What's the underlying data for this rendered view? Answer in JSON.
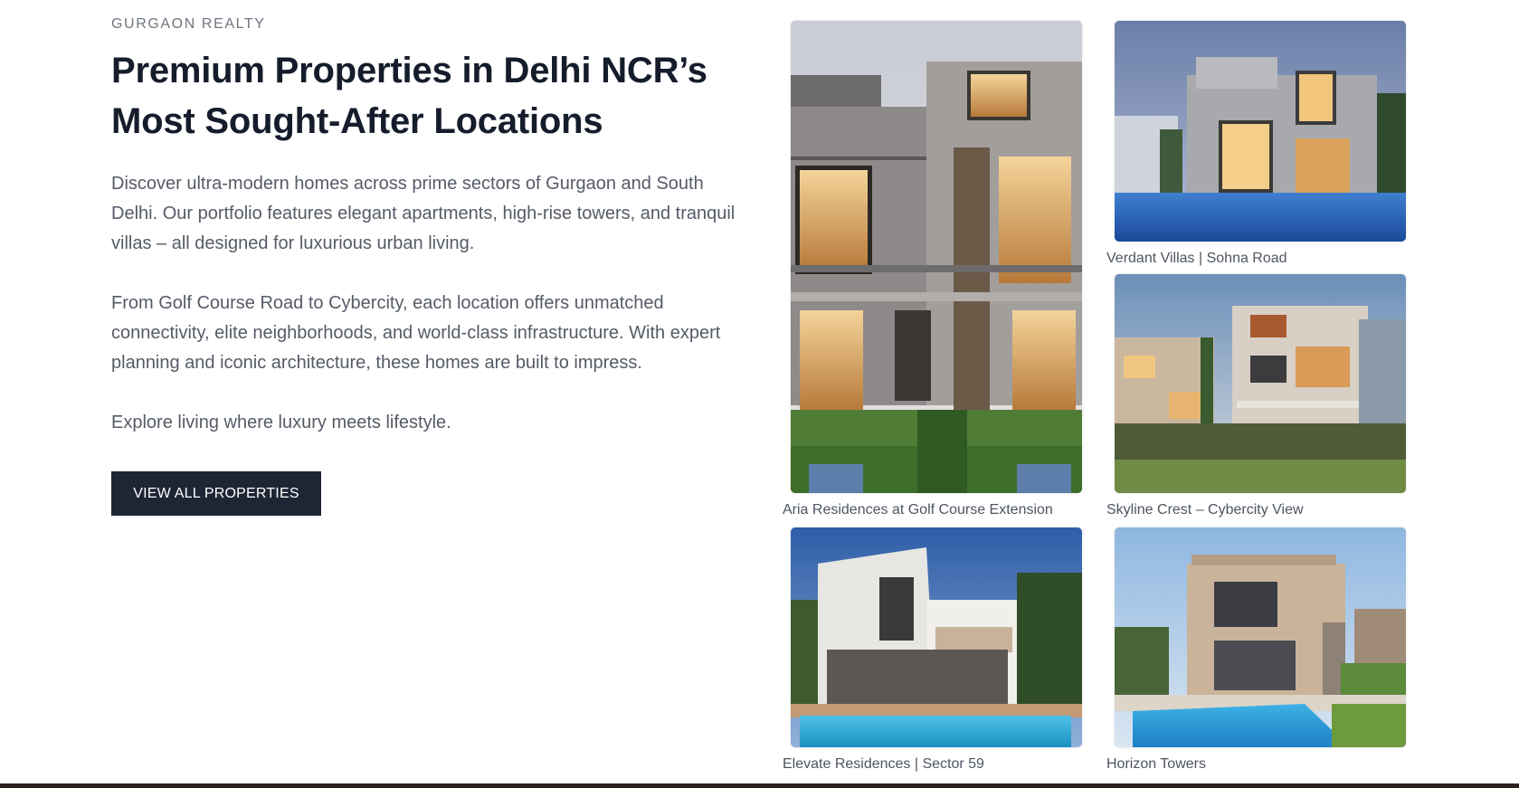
{
  "brand": {
    "eyebrow": "GURGAON REALTY"
  },
  "hero": {
    "headline_line1": "Premium Properties in Delhi NCR’s",
    "headline_line2": "Most Sought-After Locations",
    "paragraph1": "Discover ultra-modern homes across prime sectors of Gurgaon and South Delhi. Our portfolio features elegant apartments, high-rise towers, and tranquil villas – all designed for luxurious urban living.",
    "paragraph2": "From Golf Course Road to Cybercity, each location offers unmatched connectivity, elite neighborhoods, and world-class infrastructure. With expert planning and iconic architecture, these homes are built to impress.",
    "paragraph3": "Explore living where luxury meets lifestyle.",
    "cta_label": "VIEW ALL PROPERTIES"
  },
  "properties": [
    {
      "caption": "Aria Residences at Golf Course Extension",
      "image": "modern-villa-facade-dusk"
    },
    {
      "caption": "Verdant Villas | Sohna Road",
      "image": "villa-with-pool-evening"
    },
    {
      "caption": "Skyline Crest – Cybercity View",
      "image": "terraced-villas-palms"
    },
    {
      "caption": "Elevate Residences | Sector 59",
      "image": "white-villa-pool-day"
    },
    {
      "caption": "Horizon Towers",
      "image": "beige-villa-pool-day"
    }
  ],
  "colors": {
    "button_bg": "#1e2636",
    "heading": "#151c2b",
    "body_text": "#555b66",
    "footer_bar": "#2b221f"
  }
}
